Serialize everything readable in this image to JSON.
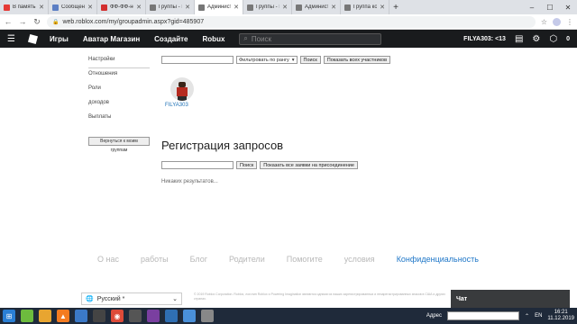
{
  "browser": {
    "tabs": [
      {
        "label": "В память бене",
        "color": "#e53935",
        "active": false
      },
      {
        "label": "Сообщения",
        "color": "#5b7ec4",
        "active": false
      },
      {
        "label": "ФФ-ФФ-нелик",
        "color": "#d32f2f",
        "active": false
      },
      {
        "label": "Группы - Robl",
        "color": "#777777",
        "active": false
      },
      {
        "label": "Администрато",
        "color": "#777777",
        "active": true
      },
      {
        "label": "Группы - Robl",
        "color": "#777777",
        "active": false
      },
      {
        "label": "Администрато",
        "color": "#777777",
        "active": false
      },
      {
        "label": "Группа комп",
        "color": "#777777",
        "active": false
      }
    ],
    "url": "web.roblox.com/my/groupadmin.aspx?gid=485907"
  },
  "roblox_nav": {
    "links": [
      "Игры",
      "Аватар Магазин",
      "Создайте",
      "Robux"
    ],
    "search_placeholder": "Поиск",
    "username": "FILYA303: <13",
    "robux": "0",
    "notif_count": "1"
  },
  "sidebar": {
    "items": [
      "Настройки",
      "Отношения",
      "Роли",
      "доходов",
      "Выплаты"
    ],
    "back_button": "Вернуться к моим",
    "back_sub": "группам"
  },
  "members": {
    "filter_label": "Фильтровать по рангу",
    "search_button": "Поиск",
    "show_all_button": "Показать всех участников",
    "list": [
      {
        "name": "FILYA303"
      }
    ]
  },
  "requests": {
    "title": "Регистрация запросов",
    "search_button": "Поиск",
    "show_all_button": "Показать все заявки на присоединение",
    "no_results": "Никаких результатов..."
  },
  "footer": {
    "links": [
      "О нас",
      "работы",
      "Блог",
      "Родители",
      "Помогите",
      "условия"
    ],
    "privacy": "Конфиденциальность",
    "language": "Русский *",
    "copyright": "© 2019 Roblox Corporation. Roblox, логотип Roblox и Powering Imagination являются одними из наших зарегистрированных и незарегистрированных знаков в США и других странах."
  },
  "chat": {
    "label": "Чат"
  },
  "taskbar": {
    "address_label": "Адрес",
    "lang": "EN",
    "time": "16:21",
    "date": "11.12.2019"
  }
}
